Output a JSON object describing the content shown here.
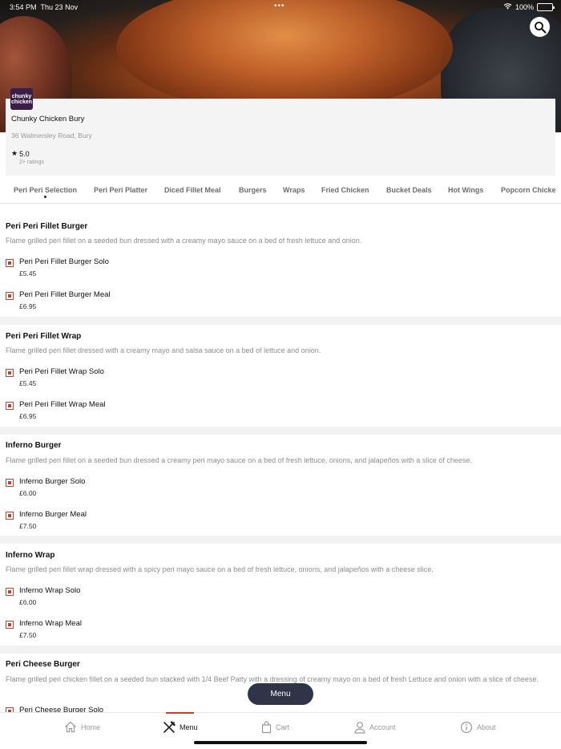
{
  "status_bar": {
    "time": "3:54 PM",
    "date": "Thu 23 Nov",
    "battery": "100%"
  },
  "restaurant": {
    "logo_text": "chunky chicken",
    "name": "Chunky Chicken Bury",
    "address": "36 Walmersley Road, Bury",
    "rating": "5.0",
    "rating_count": "2+ ratings"
  },
  "tabs": [
    {
      "label": "Peri Peri Selection",
      "active": true
    },
    {
      "label": "Peri Peri Platter"
    },
    {
      "label": "Diced Fillet Meal"
    },
    {
      "label": "Burgers"
    },
    {
      "label": "Wraps"
    },
    {
      "label": "Fried Chicken"
    },
    {
      "label": "Bucket Deals"
    },
    {
      "label": "Hot Wings"
    },
    {
      "label": "Popcorn Chicke"
    }
  ],
  "sections": [
    {
      "title": "Peri Peri Fillet Burger",
      "description": "Flame grilled peri fillet on a seeded bun dressed with a creamy mayo sauce on a bed of fresh lettuce and onion.",
      "items": [
        {
          "name": "Peri Peri Fillet Burger Solo",
          "price": "£5.45"
        },
        {
          "name": "Peri Peri Fillet Burger Meal",
          "price": "£6.95"
        }
      ]
    },
    {
      "title": "Peri Peri Fillet Wrap",
      "description": "Flame grilled peri fillet dressed with a creamy mayo and salsa sauce on a bed of lettuce and onion.",
      "items": [
        {
          "name": "Peri Peri Fillet Wrap Solo",
          "price": "£5.45"
        },
        {
          "name": "Peri Peri Fillet Wrap Meal",
          "price": "£6.95"
        }
      ]
    },
    {
      "title": "Inferno Burger",
      "description": "Flame grilled peri fillet on a seeded bun dressed a creamy peri mayo sauce on a bed of fresh lettuce, onions, and jalapeños with a slice of cheese.",
      "items": [
        {
          "name": "Inferno Burger Solo",
          "price": "£6.00"
        },
        {
          "name": "Inferno Burger Meal",
          "price": "£7.50"
        }
      ]
    },
    {
      "title": "Inferno Wrap",
      "description": "Flame grilled peri fillet wrap dressed with a spicy peri mayo sauce on a bed of fresh lettuce, onions, and jalapeños with a cheese slice.",
      "items": [
        {
          "name": "Inferno Wrap Solo",
          "price": "£6.00"
        },
        {
          "name": "Inferno Wrap Meal",
          "price": "£7.50"
        }
      ]
    },
    {
      "title": "Peri Cheese Burger",
      "description": "Flame grilled peri chicken fillet on a seeded bun stacked with 1/4 Beef Patty with a dressing of creamy mayo on a bed of fresh Lettuce and onion with a slice of cheese.",
      "items": [
        {
          "name": "Peri Cheese Burger Solo",
          "price": ""
        }
      ]
    }
  ],
  "floating_button": {
    "label": "Menu"
  },
  "bottom_nav": [
    {
      "label": "Home",
      "icon": "home-icon"
    },
    {
      "label": "Menu",
      "icon": "fork-knife-icon",
      "active": true
    },
    {
      "label": "Cart",
      "icon": "cart-icon"
    },
    {
      "label": "Account",
      "icon": "account-icon"
    },
    {
      "label": "About",
      "icon": "info-icon"
    }
  ],
  "colors": {
    "accent": "#c2412a",
    "menu_button": "#2f3446",
    "logo_bg": "#3b1d4a"
  }
}
